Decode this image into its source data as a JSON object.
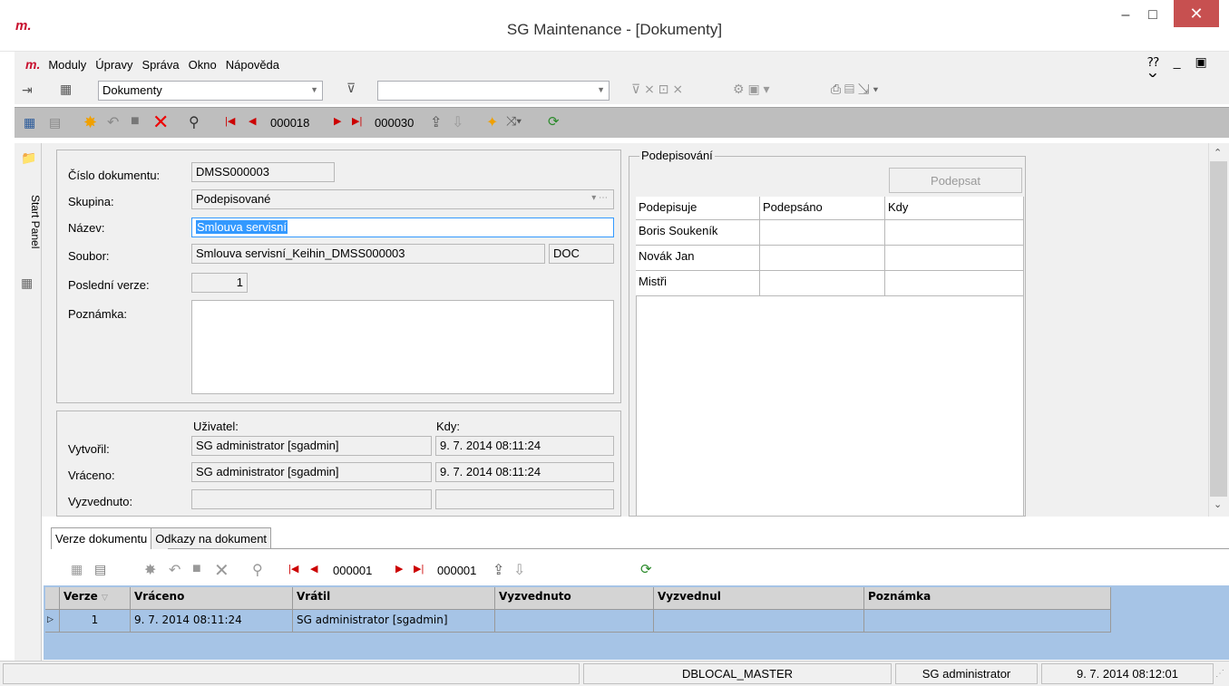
{
  "window": {
    "logo": "m.",
    "title": "SG Maintenance - [Dokumenty]",
    "controls": {
      "minimize": "–",
      "maximize": "□",
      "close": "✕"
    }
  },
  "menu": {
    "logo": "m.",
    "items": [
      "Moduly",
      "Úpravy",
      "Správa",
      "Okno",
      "Nápověda"
    ],
    "mdi_controls": "⁇ _ ▣ ✕"
  },
  "toolbar1": {
    "module_combo": "Dokumenty",
    "filter_combo": ""
  },
  "toolbar2": {
    "current_record": "000018",
    "total_records": "000030"
  },
  "side_panel": {
    "label": "Start Panel"
  },
  "document": {
    "cislo_label": "Číslo dokumentu:",
    "cislo_value": "DMSS000003",
    "skupina_label": "Skupina:",
    "skupina_value": "Podepisované",
    "nazev_label": "Název:",
    "nazev_value": "Smlouva servisní",
    "soubor_label": "Soubor:",
    "soubor_value": "Smlouva servisní_Keihin_DMSS000003",
    "soubor_ext": "DOC",
    "posledni_verze_label": "Poslední verze:",
    "posledni_verze_value": "1",
    "poznamka_label": "Poznámka:",
    "poznamka_value": ""
  },
  "audit": {
    "uzivatel_header": "Uživatel:",
    "kdy_header": "Kdy:",
    "rows": [
      {
        "label": "Vytvořil:",
        "user": "SG administrator [sgadmin]",
        "when": "9. 7. 2014 08:11:24"
      },
      {
        "label": "Vráceno:",
        "user": "SG administrator [sgadmin]",
        "when": "9. 7. 2014 08:11:24"
      },
      {
        "label": "Vyzvednuto:",
        "user": "",
        "when": ""
      }
    ]
  },
  "signing": {
    "group_title": "Podepisování",
    "sign_button": "Podepsat",
    "columns": [
      "Podepisuje",
      "Podepsáno",
      "Kdy"
    ],
    "rows": [
      [
        "Boris Soukeník",
        "",
        ""
      ],
      [
        "Novák Jan",
        "",
        ""
      ],
      [
        "Mistři",
        "",
        ""
      ]
    ]
  },
  "tabs": [
    "Verze dokumentu",
    "Odkazy na dokument"
  ],
  "bottom_toolbar": {
    "current_record": "000001",
    "total_records": "000001"
  },
  "versions_grid": {
    "columns": [
      "Verze",
      "Vráceno",
      "Vrátil",
      "Vyzvednuto",
      "Vyzvednul",
      "Poznámka"
    ],
    "rows": [
      [
        "1",
        "9. 7. 2014 08:11:24",
        "SG administrator [sgadmin]",
        "",
        "",
        ""
      ]
    ]
  },
  "statusbar": {
    "database": "DBLOCAL_MASTER",
    "user": "SG administrator",
    "datetime": "9. 7. 2014 08:12:01"
  }
}
